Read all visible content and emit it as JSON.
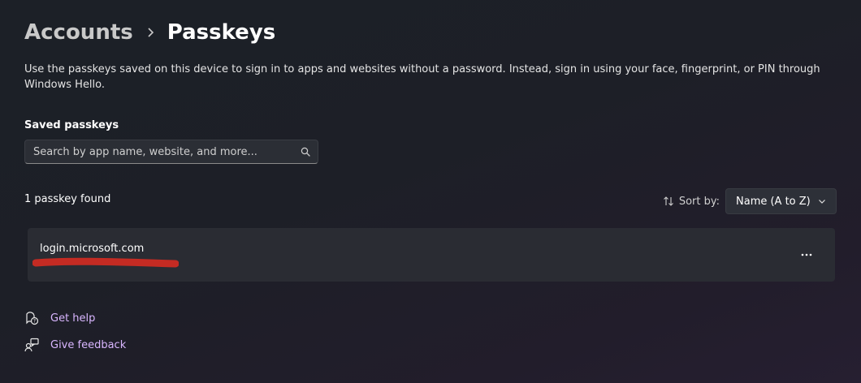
{
  "breadcrumb": {
    "parent": "Accounts",
    "current": "Passkeys"
  },
  "description": "Use the passkeys saved on this device to sign in to apps and websites without a password. Instead, sign in using your face, fingerprint, or PIN through Windows Hello.",
  "saved_section": {
    "title": "Saved passkeys",
    "search_placeholder": "Search by app name, website, and more...",
    "search_value": ""
  },
  "results": {
    "count_text": "1 passkey found",
    "sort_label": "Sort by:",
    "sort_value": "Name (A to Z)"
  },
  "passkeys": [
    {
      "site": "login.microsoft.com",
      "more_label": "More options"
    }
  ],
  "footer_links": [
    {
      "label": "Get help",
      "icon": "help-chat-icon"
    },
    {
      "label": "Give feedback",
      "icon": "feedback-icon"
    }
  ],
  "colors": {
    "accent_link": "#d9b6ff",
    "redaction": "#c42b23",
    "card_background": "#2a2c33"
  }
}
